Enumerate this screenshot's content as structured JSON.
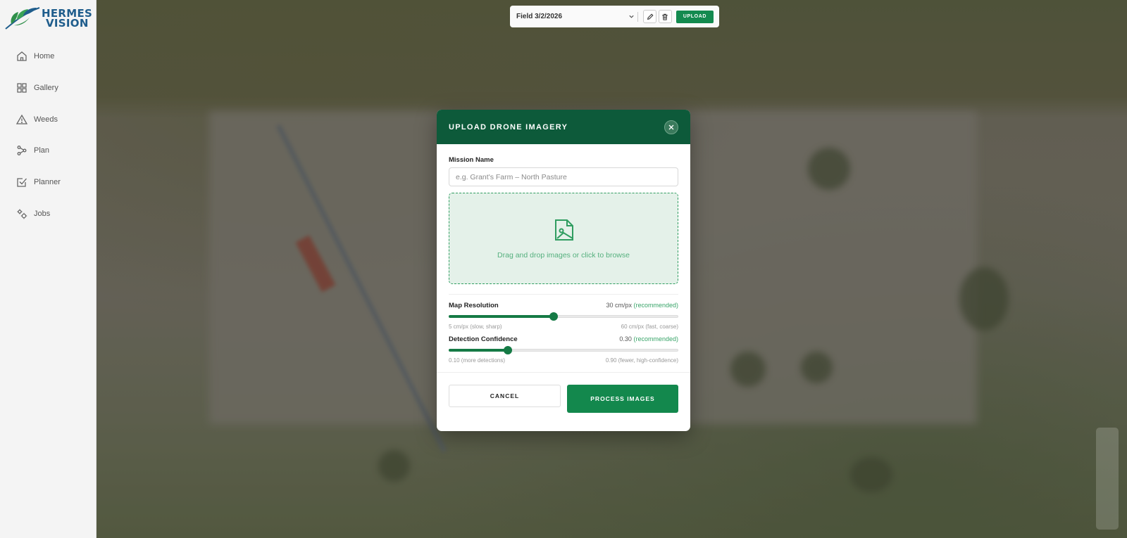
{
  "brand": {
    "line1": "HERMES",
    "line2": "VISION"
  },
  "sidebar": {
    "items": [
      {
        "label": "Home",
        "icon": "home-icon"
      },
      {
        "label": "Gallery",
        "icon": "grid-icon"
      },
      {
        "label": "Weeds",
        "icon": "warning-icon"
      },
      {
        "label": "Plan",
        "icon": "route-icon"
      },
      {
        "label": "Planner",
        "icon": "checkbox-icon"
      },
      {
        "label": "Jobs",
        "icon": "gear-icon"
      }
    ]
  },
  "toolbar": {
    "selected_field": "Field 3/2/2026",
    "upload_label": "UPLOAD"
  },
  "modal": {
    "title": "UPLOAD DRONE IMAGERY",
    "mission_label": "Mission Name",
    "mission_placeholder": "e.g. Grant's Farm – North Pasture",
    "mission_value": "",
    "dropzone_text": "Drag and drop images or click to browse",
    "resolution": {
      "label": "Map Resolution",
      "value_text": "30 cm/px",
      "recommended": "(recommended)",
      "fraction": 0.457,
      "min_hint": "5 cm/px (slow, sharp)",
      "max_hint": "60 cm/px (fast, coarse)"
    },
    "confidence": {
      "label": "Detection Confidence",
      "value_text": "0.30",
      "recommended": "(recommended)",
      "fraction": 0.257,
      "min_hint": "0.10 (more detections)",
      "max_hint": "0.90 (fewer, high-confidence)"
    },
    "cancel_label": "CANCEL",
    "process_label": "PROCESS IMAGES"
  },
  "colors": {
    "accent": "#138a4f",
    "header": "#0d5a3a",
    "brand_blue": "#1f5d8c"
  }
}
